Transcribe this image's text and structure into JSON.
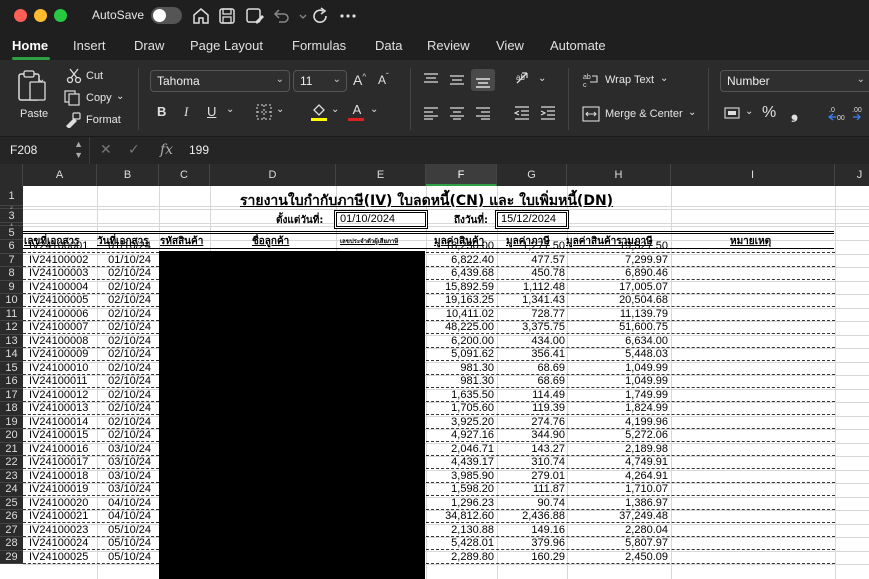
{
  "titlebar": {
    "autosave_label": "AutoSave",
    "icons": [
      "home-icon",
      "save-icon",
      "save-as-icon",
      "undo-icon",
      "redo-icon",
      "more-icon"
    ]
  },
  "tabs": [
    "Home",
    "Insert",
    "Draw",
    "Page Layout",
    "Formulas",
    "Data",
    "Review",
    "View",
    "Automate"
  ],
  "active_tab": "Home",
  "ribbon": {
    "paste": "Paste",
    "cut": "Cut",
    "copy": "Copy",
    "format": "Format",
    "font_name": "Tahoma",
    "font_size": "11",
    "bold": "B",
    "italic": "I",
    "underline": "U",
    "font_color_glyph": "A",
    "wrap_text": "Wrap Text",
    "merge_center": "Merge & Center",
    "number_format": "Number",
    "percent": "%",
    "comma": "❟",
    "accent": "#2ea043",
    "highlight_color": "#ffff00",
    "font_color": "#e02020"
  },
  "formula_bar": {
    "cell_ref": "F208",
    "fx": "fx",
    "value": "199"
  },
  "sheet": {
    "columns": [
      "A",
      "B",
      "C",
      "D",
      "E",
      "F",
      "G",
      "H",
      "I",
      "J"
    ],
    "selected_column": "F",
    "row_numbers": [
      "1",
      "2",
      "3",
      "4",
      "5",
      "6",
      "7",
      "8",
      "9",
      "10",
      "11",
      "12",
      "13",
      "14",
      "15",
      "16",
      "17",
      "18",
      "19",
      "20",
      "21",
      "22",
      "23",
      "24",
      "25",
      "26",
      "27",
      "28",
      "29"
    ],
    "title": "รายงานใบกำกับภาษี(IV) ใบลดหนี้(CN) และ ใบเพิ่มหนี้(DN)",
    "from_label": "ตั้งแต่วันที่:",
    "from_date": "01/10/2024",
    "to_label": "ถึงวันที่:",
    "to_date": "15/12/2024",
    "headers": {
      "doc_no": "เลขที่เอกสาร",
      "doc_date": "วันที่เอกสาร",
      "product_code": "รหัสสินค้า",
      "customer_name": "ชื่อลูกค้า",
      "tax_id": "เลขประจำตัวผู้เสียภาษี",
      "product_value": "มูลค่าสินค้า",
      "tax_value": "มูลค่าภาษี",
      "total_value": "มูลค่าสินค้ารวมภาษี",
      "remark": "หมายเหตุ"
    },
    "rows": [
      {
        "doc": "IV24100001",
        "date": "01/10/24",
        "value": "18,250.00",
        "tax": "1,277.50",
        "total": "19,527.50"
      },
      {
        "doc": "IV24100002",
        "date": "01/10/24",
        "value": "6,822.40",
        "tax": "477.57",
        "total": "7,299.97"
      },
      {
        "doc": "IV24100003",
        "date": "02/10/24",
        "value": "6,439.68",
        "tax": "450.78",
        "total": "6,890.46"
      },
      {
        "doc": "IV24100004",
        "date": "02/10/24",
        "value": "15,892.59",
        "tax": "1,112.48",
        "total": "17,005.07"
      },
      {
        "doc": "IV24100005",
        "date": "02/10/24",
        "value": "19,163.25",
        "tax": "1,341.43",
        "total": "20,504.68"
      },
      {
        "doc": "IV24100006",
        "date": "02/10/24",
        "value": "10,411.02",
        "tax": "728.77",
        "total": "11,139.79"
      },
      {
        "doc": "IV24100007",
        "date": "02/10/24",
        "value": "48,225.00",
        "tax": "3,375.75",
        "total": "51,600.75"
      },
      {
        "doc": "IV24100008",
        "date": "02/10/24",
        "value": "6,200.00",
        "tax": "434.00",
        "total": "6,634.00"
      },
      {
        "doc": "IV24100009",
        "date": "02/10/24",
        "value": "5,091.62",
        "tax": "356.41",
        "total": "5,448.03"
      },
      {
        "doc": "IV24100010",
        "date": "02/10/24",
        "value": "981.30",
        "tax": "68.69",
        "total": "1,049.99"
      },
      {
        "doc": "IV24100011",
        "date": "02/10/24",
        "value": "981.30",
        "tax": "68.69",
        "total": "1,049.99"
      },
      {
        "doc": "IV24100012",
        "date": "02/10/24",
        "value": "1,635.50",
        "tax": "114.49",
        "total": "1,749.99"
      },
      {
        "doc": "IV24100013",
        "date": "02/10/24",
        "value": "1,705.60",
        "tax": "119.39",
        "total": "1,824.99"
      },
      {
        "doc": "IV24100014",
        "date": "02/10/24",
        "value": "3,925.20",
        "tax": "274.76",
        "total": "4,199.96"
      },
      {
        "doc": "IV24100015",
        "date": "02/10/24",
        "value": "4,927.16",
        "tax": "344.90",
        "total": "5,272.06"
      },
      {
        "doc": "IV24100016",
        "date": "03/10/24",
        "value": "2,046.71",
        "tax": "143.27",
        "total": "2,189.98"
      },
      {
        "doc": "IV24100017",
        "date": "03/10/24",
        "value": "4,439.17",
        "tax": "310.74",
        "total": "4,749.91"
      },
      {
        "doc": "IV24100018",
        "date": "03/10/24",
        "value": "3,985.90",
        "tax": "279.01",
        "total": "4,264.91"
      },
      {
        "doc": "IV24100019",
        "date": "03/10/24",
        "value": "1,598.20",
        "tax": "111.87",
        "total": "1,710.07"
      },
      {
        "doc": "IV24100020",
        "date": "04/10/24",
        "value": "1,296.23",
        "tax": "90.74",
        "total": "1,386.97"
      },
      {
        "doc": "IV24100021",
        "date": "04/10/24",
        "value": "34,812.60",
        "tax": "2,436.88",
        "total": "37,249.48"
      },
      {
        "doc": "IV24100023",
        "date": "05/10/24",
        "value": "2,130.88",
        "tax": "149.16",
        "total": "2,280.04"
      },
      {
        "doc": "IV24100024",
        "date": "05/10/24",
        "value": "5,428.01",
        "tax": "379.96",
        "total": "5,807.97"
      },
      {
        "doc": "IV24100025",
        "date": "05/10/24",
        "value": "2,289.80",
        "tax": "160.29",
        "total": "2,450.09"
      }
    ]
  }
}
